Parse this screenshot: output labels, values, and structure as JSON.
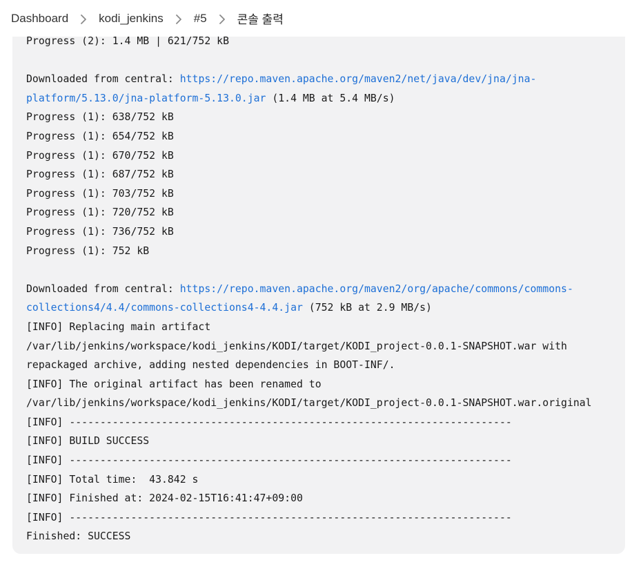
{
  "breadcrumb": {
    "items": [
      {
        "label": "Dashboard"
      },
      {
        "label": "kodi_jenkins"
      },
      {
        "label": "#5"
      },
      {
        "label": "콘솔 출력"
      }
    ],
    "separator_icon": "chevron-right-icon"
  },
  "console": {
    "lines": [
      {
        "text": "Progress (2): 1.4 MB | 621/752 kB"
      },
      {
        "text": ""
      },
      {
        "prefix": "Downloaded from central: ",
        "link": "https://repo.maven.apache.org/maven2/net/java/dev/jna/jna-",
        "suffix": ""
      },
      {
        "prefix": "",
        "link": "platform/5.13.0/jna-platform-5.13.0.jar",
        "suffix": " (1.4 MB at 5.4 MB/s)"
      },
      {
        "text": "Progress (1): 638/752 kB"
      },
      {
        "text": "Progress (1): 654/752 kB"
      },
      {
        "text": "Progress (1): 670/752 kB"
      },
      {
        "text": "Progress (1): 687/752 kB"
      },
      {
        "text": "Progress (1): 703/752 kB"
      },
      {
        "text": "Progress (1): 720/752 kB"
      },
      {
        "text": "Progress (1): 736/752 kB"
      },
      {
        "text": "Progress (1): 752 kB"
      },
      {
        "text": ""
      },
      {
        "prefix": "Downloaded from central: ",
        "link": "https://repo.maven.apache.org/maven2/org/apache/commons/commons-",
        "suffix": ""
      },
      {
        "prefix": "",
        "link": "collections4/4.4/commons-collections4-4.4.jar",
        "suffix": " (752 kB at 2.9 MB/s)"
      },
      {
        "text": "[INFO] Replacing main artifact"
      },
      {
        "text": "/var/lib/jenkins/workspace/kodi_jenkins/KODI/target/KODI_project-0.0.1-SNAPSHOT.war with"
      },
      {
        "text": "repackaged archive, adding nested dependencies in BOOT-INF/."
      },
      {
        "text": "[INFO] The original artifact has been renamed to"
      },
      {
        "text": "/var/lib/jenkins/workspace/kodi_jenkins/KODI/target/KODI_project-0.0.1-SNAPSHOT.war.original"
      },
      {
        "text": "[INFO] ------------------------------------------------------------------------"
      },
      {
        "text": "[INFO] BUILD SUCCESS"
      },
      {
        "text": "[INFO] ------------------------------------------------------------------------"
      },
      {
        "text": "[INFO] Total time:  43.842 s"
      },
      {
        "text": "[INFO] Finished at: 2024-02-15T16:41:47+09:00"
      },
      {
        "text": "[INFO] ------------------------------------------------------------------------"
      },
      {
        "text": "Finished: SUCCESS"
      }
    ],
    "colors": {
      "background": "#f2f2f3",
      "text": "#1a1a1a",
      "link": "#1d6fd6"
    }
  }
}
